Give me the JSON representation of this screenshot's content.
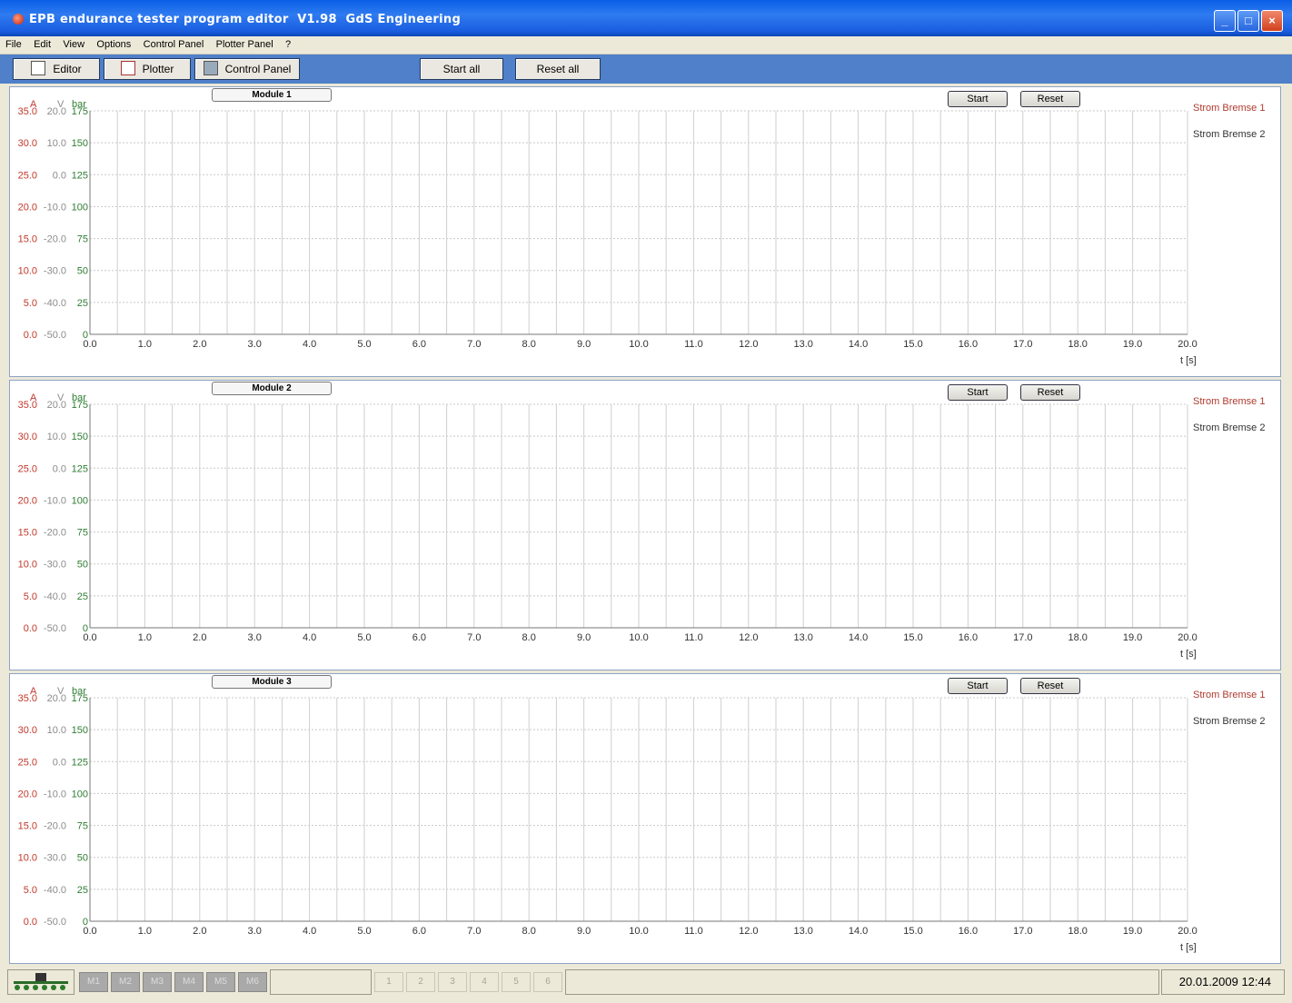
{
  "window": {
    "title": "EPB endurance tester program editor  V1.98  GdS Engineering",
    "minimize_label": "_",
    "maximize_label": "□",
    "close_label": "×"
  },
  "menu": [
    "File",
    "Edit",
    "View",
    "Options",
    "Control Panel",
    "Plotter Panel",
    "?"
  ],
  "toolbar": {
    "editor_label": "Editor",
    "plotter_label": "Plotter",
    "control_panel_label": "Control Panel",
    "start_all_label": "Start all",
    "reset_all_label": "Reset all"
  },
  "axes": {
    "a_header": "A",
    "v_header": "V",
    "bar_header": "bar",
    "a_ticks": [
      "35.0",
      "30.0",
      "25.0",
      "20.0",
      "15.0",
      "10.0",
      "5.0",
      "0.0"
    ],
    "v_ticks": [
      "20.0",
      "10.0",
      "0.0",
      "-10.0",
      "-20.0",
      "-30.0",
      "-40.0",
      "-50.0"
    ],
    "bar_ticks": [
      "175",
      "150",
      "125",
      "100",
      "75",
      "50",
      "25",
      "0"
    ],
    "x_ticks": [
      "0.0",
      "1.0",
      "2.0",
      "3.0",
      "4.0",
      "5.0",
      "6.0",
      "7.0",
      "8.0",
      "9.0",
      "10.0",
      "11.0",
      "12.0",
      "13.0",
      "14.0",
      "15.0",
      "16.0",
      "17.0",
      "18.0",
      "19.0",
      "20.0"
    ],
    "x_unit": "t [s]",
    "colors": {
      "a": "#c0392b",
      "v": "#8c8c8c",
      "bar": "#2e7d32"
    }
  },
  "modules": [
    {
      "label": "Module 1",
      "start": "Start",
      "reset": "Reset",
      "legend": [
        "Strom Bremse 1",
        "Strom Bremse 2"
      ]
    },
    {
      "label": "Module 2",
      "start": "Start",
      "reset": "Reset",
      "legend": [
        "Strom Bremse 1",
        "Strom Bremse 2"
      ]
    },
    {
      "label": "Module 3",
      "start": "Start",
      "reset": "Reset",
      "legend": [
        "Strom Bremse 1",
        "Strom Bremse 2"
      ]
    }
  ],
  "legend_colors": [
    "#b03a2e",
    "#333333"
  ],
  "status": {
    "modules": [
      "M1",
      "M2",
      "M3",
      "M4",
      "M5",
      "M6"
    ],
    "numbers": [
      "1",
      "2",
      "3",
      "4",
      "5",
      "6"
    ],
    "datetime": "20.01.2009 12:44"
  }
}
